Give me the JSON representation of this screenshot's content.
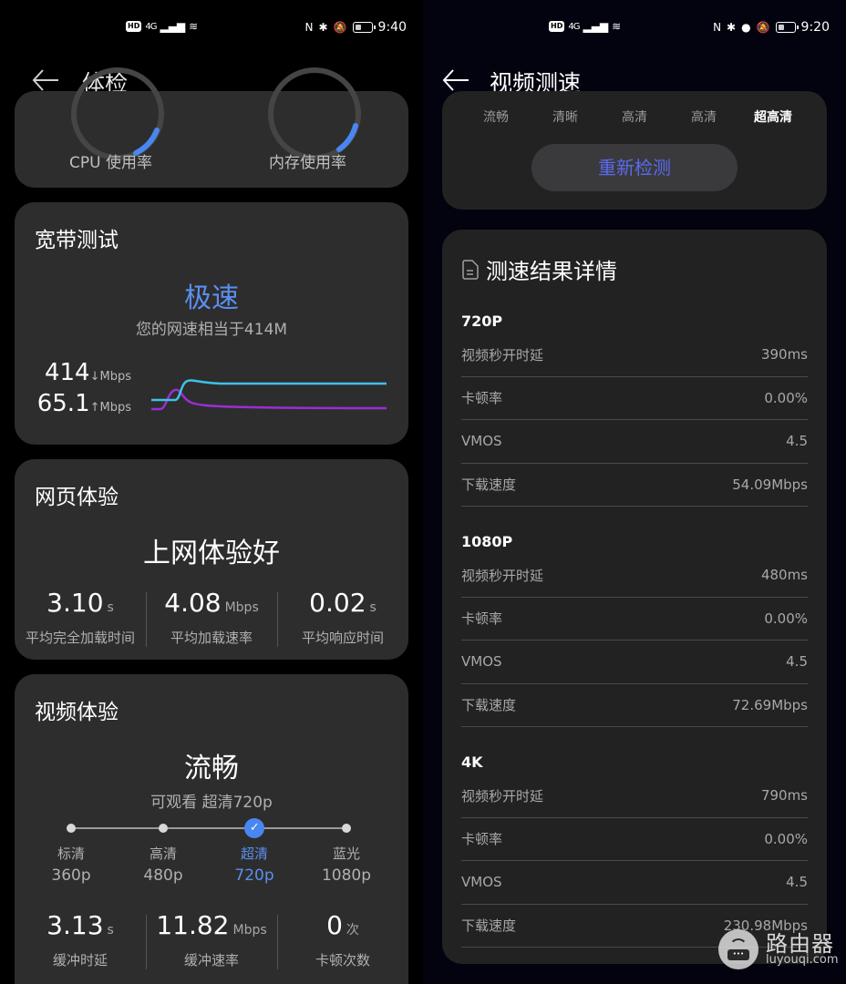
{
  "left_screen": {
    "status_bar": {
      "hd_badge": "HD",
      "network": "4G",
      "signal_icon": "signal-bars-icon",
      "wifi_icon": "wifi6-icon",
      "nfc_icon": "N",
      "bluetooth_icon": "✱",
      "silent_icon": "🔕",
      "battery_level": 0.35,
      "time": "9:40"
    },
    "app_bar": {
      "back_icon": "back-arrow-icon",
      "title": "体检"
    },
    "system_card": {
      "gauges": [
        {
          "label": "CPU 使用率"
        },
        {
          "label": "内存使用率"
        }
      ]
    },
    "broadband": {
      "title": "宽带测试",
      "rating": "极速",
      "subtitle": "您的网速相当于414M",
      "download_value": "414",
      "download_unit": "↓Mbps",
      "upload_value": "65.1",
      "upload_unit": "↑Mbps",
      "colors": {
        "download": "#3fc1e8",
        "upload": "#9a2ed6",
        "accent": "#5b8ff0"
      }
    },
    "web": {
      "title": "网页体验",
      "rating": "上网体验好",
      "stats": [
        {
          "value": "3.10",
          "unit": "s",
          "label": "平均完全加载时间"
        },
        {
          "value": "4.08",
          "unit": "Mbps",
          "label": "平均加载速率"
        },
        {
          "value": "0.02",
          "unit": "s",
          "label": "平均响应时间"
        }
      ]
    },
    "video": {
      "title": "视频体验",
      "rating": "流畅",
      "subtitle": "可观看 超清720p",
      "qualities": [
        {
          "name": "标清",
          "res": "360p",
          "selected": false
        },
        {
          "name": "高清",
          "res": "480p",
          "selected": false
        },
        {
          "name": "超清",
          "res": "720p",
          "selected": true
        },
        {
          "name": "蓝光",
          "res": "1080p",
          "selected": false
        }
      ],
      "check_icon": "✓",
      "stats": [
        {
          "value": "3.13",
          "unit": "s",
          "label": "缓冲时延"
        },
        {
          "value": "11.82",
          "unit": "Mbps",
          "label": "缓冲速率"
        },
        {
          "value": "0",
          "unit": "次",
          "label": "卡顿次数"
        }
      ]
    }
  },
  "right_screen": {
    "status_bar": {
      "hd_badge": "HD",
      "network": "4G",
      "nfc_icon": "N",
      "bluetooth_icon": "✱",
      "location_icon": "●",
      "silent_icon": "🔕",
      "battery_level": 0.35,
      "time": "9:20"
    },
    "app_bar": {
      "back_icon": "back-arrow-icon",
      "title": "视频测速"
    },
    "resolution_tabs": [
      "流畅",
      "清晰",
      "高清",
      "高清",
      "超高清"
    ],
    "active_tab_index": 4,
    "retest_button": "重新检测",
    "detail": {
      "title": "测速结果详情",
      "groups": [
        {
          "name": "720P",
          "rows": [
            {
              "label": "视频秒开时延",
              "value": "390ms"
            },
            {
              "label": "卡顿率",
              "value": "0.00%"
            },
            {
              "label": "VMOS",
              "value": "4.5"
            },
            {
              "label": "下载速度",
              "value": "54.09Mbps"
            }
          ]
        },
        {
          "name": "1080P",
          "rows": [
            {
              "label": "视频秒开时延",
              "value": "480ms"
            },
            {
              "label": "卡顿率",
              "value": "0.00%"
            },
            {
              "label": "VMOS",
              "value": "4.5"
            },
            {
              "label": "下载速度",
              "value": "72.69Mbps"
            }
          ]
        },
        {
          "name": "4K",
          "rows": [
            {
              "label": "视频秒开时延",
              "value": "790ms"
            },
            {
              "label": "卡顿率",
              "value": "0.00%"
            },
            {
              "label": "VMOS",
              "value": "4.5"
            },
            {
              "label": "下载速度",
              "value": "230.98Mbps"
            }
          ]
        }
      ]
    }
  },
  "watermark": {
    "title": "路由器",
    "url": "luyouqi.com",
    "router_dots": "•••"
  }
}
